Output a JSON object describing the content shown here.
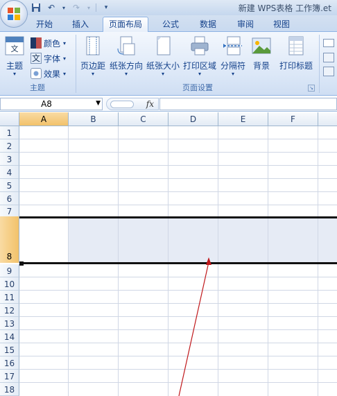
{
  "window": {
    "title": "新建 WPS表格 工作簿.et"
  },
  "tabs": [
    {
      "label": "开始"
    },
    {
      "label": "插入"
    },
    {
      "label": "页面布局",
      "active": true
    },
    {
      "label": "公式"
    },
    {
      "label": "数据"
    },
    {
      "label": "审阅"
    },
    {
      "label": "视图"
    }
  ],
  "ribbon": {
    "theme_group": {
      "label": "主题",
      "theme_button": "主题",
      "theme_icon_text": "文",
      "color_button": "颜色",
      "font_button": "字体",
      "font_icon_text": "文",
      "effect_button": "效果"
    },
    "page_setup_group": {
      "label": "页面设置",
      "buttons": [
        "页边距",
        "纸张方向",
        "纸张大小",
        "打印区域",
        "分隔符",
        "背景",
        "打印标题"
      ]
    }
  },
  "formula_bar": {
    "name_box": "A8",
    "fx_label": "fx",
    "formula": ""
  },
  "sheet": {
    "columns": [
      "A",
      "B",
      "C",
      "D",
      "E",
      "F"
    ],
    "rows": [
      "1",
      "2",
      "3",
      "4",
      "5",
      "6",
      "7",
      "8",
      "9",
      "10",
      "11",
      "12",
      "13",
      "14",
      "15",
      "16",
      "17",
      "18"
    ],
    "active_cell": "A8",
    "selected_row": "8",
    "selected_column": "A"
  },
  "colors": {
    "ribbon_text": "#15428b",
    "selection_header": "#f2c26a",
    "selection_fill": "#e6ebf5",
    "annotation_arrow": "#c0181b",
    "gridline": "#d0d7e5"
  }
}
